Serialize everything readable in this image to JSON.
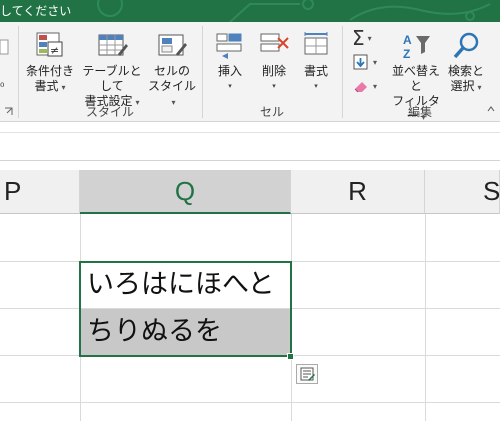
{
  "title": {
    "text": "してください"
  },
  "ribbon": {
    "style_group": {
      "label": "スタイル",
      "conditional": {
        "line1": "条件付き",
        "line2": "書式"
      },
      "as_table": {
        "line1": "テーブルとして",
        "line2": "書式設定"
      },
      "cell_style": {
        "line1": "セルの",
        "line2": "スタイル"
      }
    },
    "cell_group": {
      "label": "セル",
      "insert": "挿入",
      "delete": "削除",
      "format": "書式"
    },
    "edit_group": {
      "label": "編集",
      "sort_filter": {
        "line1": "並べ替えと",
        "line2": "フィルター"
      },
      "find_select": {
        "line1": "検索と",
        "line2": "選択"
      }
    }
  },
  "columns": [
    "P",
    "Q",
    "R",
    "S"
  ],
  "selected_column": "Q",
  "cells": {
    "q_row2": "いろはにほへと",
    "q_row3": "ちりぬるを"
  },
  "colors": {
    "accent": "#217346",
    "selection_fill": "#c8c8c8"
  }
}
